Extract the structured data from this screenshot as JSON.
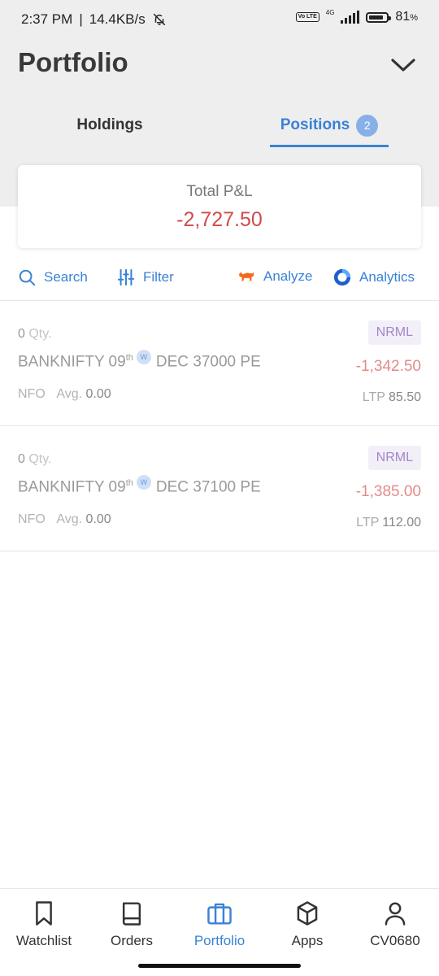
{
  "status_bar": {
    "time": "2:37 PM",
    "speed": "14.4KB/s",
    "network_badge": "Vo LTE",
    "network_type": "4G",
    "battery": "81",
    "battery_unit": "%",
    "battery_level": 0.81
  },
  "header": {
    "title": "Portfolio",
    "tabs": [
      {
        "label": "Holdings",
        "active": false
      },
      {
        "label": "Positions",
        "active": true,
        "badge": "2"
      }
    ]
  },
  "summary": {
    "label": "Total P&L",
    "value": "-2,727.50"
  },
  "toolbar": {
    "search": "Search",
    "filter": "Filter",
    "analyze": "Analyze",
    "analytics": "Analytics"
  },
  "positions": [
    {
      "qty": "0",
      "qty_label": "Qty.",
      "symbol_pre": "BANKNIFTY 09",
      "symbol_sup": "th",
      "weekly_badge": "W",
      "symbol_post": "DEC 37000 PE",
      "exchange": "NFO",
      "avg_label": "Avg.",
      "avg_value": "0.00",
      "product": "NRML",
      "pnl": "-1,342.50",
      "ltp_label": "LTP",
      "ltp_value": "85.50"
    },
    {
      "qty": "0",
      "qty_label": "Qty.",
      "symbol_pre": "BANKNIFTY 09",
      "symbol_sup": "th",
      "weekly_badge": "W",
      "symbol_post": "DEC 37100 PE",
      "exchange": "NFO",
      "avg_label": "Avg.",
      "avg_value": "0.00",
      "product": "NRML",
      "pnl": "-1,385.00",
      "ltp_label": "LTP",
      "ltp_value": "112.00"
    }
  ],
  "bottom_nav": [
    {
      "label": "Watchlist",
      "icon": "bookmark-icon",
      "active": false
    },
    {
      "label": "Orders",
      "icon": "book-icon",
      "active": false
    },
    {
      "label": "Portfolio",
      "icon": "briefcase-icon",
      "active": true
    },
    {
      "label": "Apps",
      "icon": "cube-icon",
      "active": false
    },
    {
      "label": "CV0680",
      "icon": "user-icon",
      "active": false
    }
  ],
  "colors": {
    "accent": "#3b82d6",
    "loss": "#d14b4b",
    "loss_light": "#e38b8b",
    "product_badge": "#a187c9",
    "analyze_icon": "#f26b1d"
  }
}
